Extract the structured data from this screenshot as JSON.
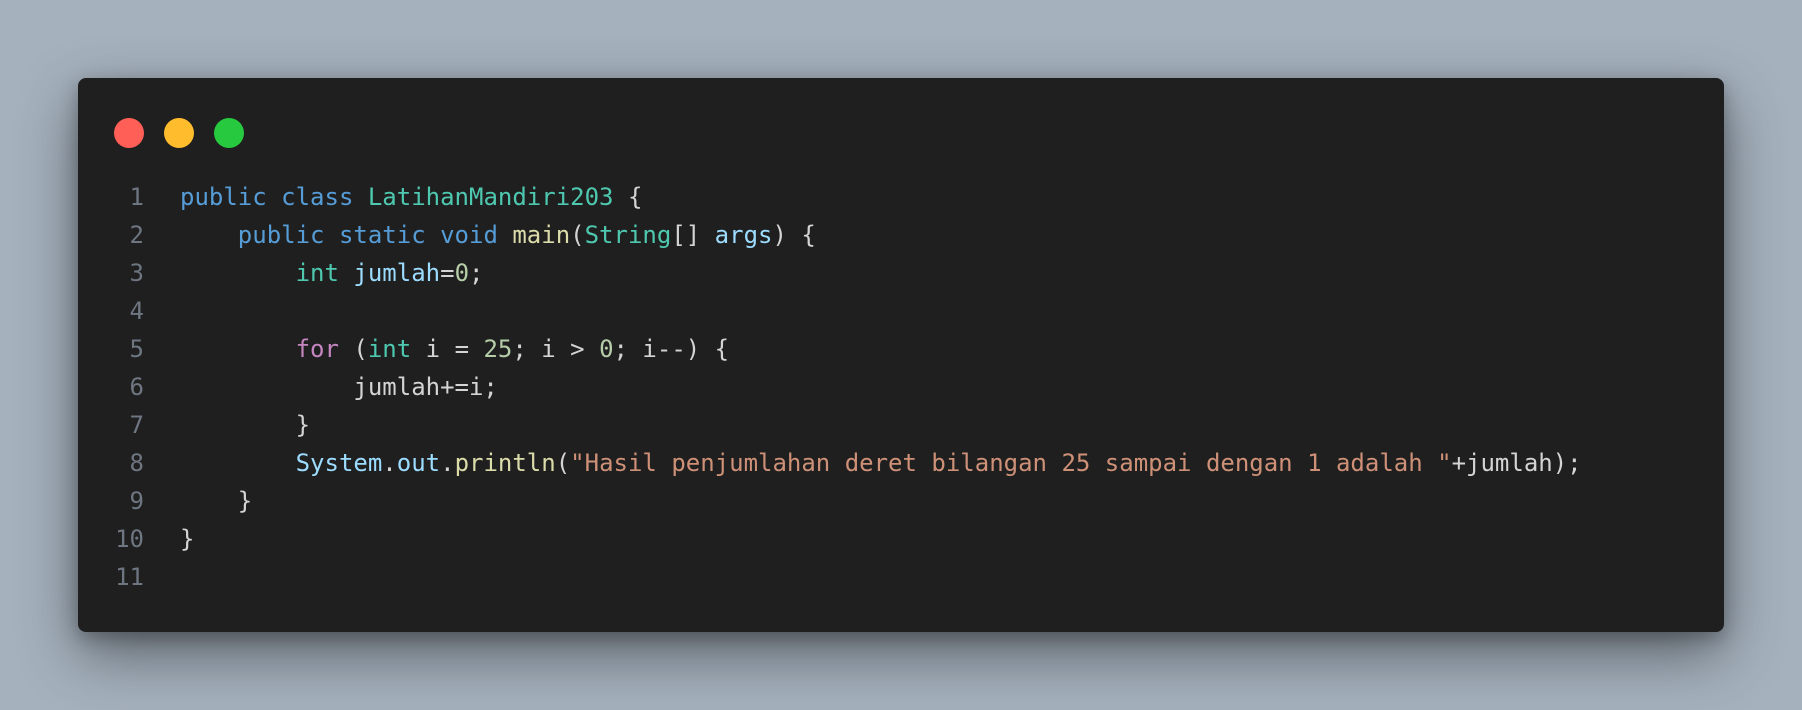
{
  "window": {
    "controls": {
      "close_color": "#ff5f56",
      "minimize_color": "#ffbd2e",
      "maximize_color": "#27c93f"
    }
  },
  "code": {
    "language": "java",
    "lines": [
      {
        "number": "1",
        "tokens": [
          {
            "t": "public",
            "c": "kw"
          },
          {
            "t": " ",
            "c": "pl"
          },
          {
            "t": "class",
            "c": "kw"
          },
          {
            "t": " ",
            "c": "pl"
          },
          {
            "t": "LatihanMandiri203",
            "c": "ty"
          },
          {
            "t": " {",
            "c": "pl"
          }
        ]
      },
      {
        "number": "2",
        "tokens": [
          {
            "t": "    ",
            "c": "pl"
          },
          {
            "t": "public",
            "c": "kw"
          },
          {
            "t": " ",
            "c": "pl"
          },
          {
            "t": "static",
            "c": "kw"
          },
          {
            "t": " ",
            "c": "pl"
          },
          {
            "t": "void",
            "c": "kw"
          },
          {
            "t": " ",
            "c": "pl"
          },
          {
            "t": "main",
            "c": "fn"
          },
          {
            "t": "(",
            "c": "pl"
          },
          {
            "t": "String",
            "c": "ty"
          },
          {
            "t": "[] ",
            "c": "pl"
          },
          {
            "t": "args",
            "c": "var"
          },
          {
            "t": ") {",
            "c": "pl"
          }
        ]
      },
      {
        "number": "3",
        "tokens": [
          {
            "t": "        ",
            "c": "pl"
          },
          {
            "t": "int",
            "c": "ty"
          },
          {
            "t": " ",
            "c": "pl"
          },
          {
            "t": "jumlah",
            "c": "var"
          },
          {
            "t": "=",
            "c": "pl"
          },
          {
            "t": "0",
            "c": "num"
          },
          {
            "t": ";",
            "c": "pl"
          }
        ]
      },
      {
        "number": "4",
        "tokens": []
      },
      {
        "number": "5",
        "tokens": [
          {
            "t": "        ",
            "c": "pl"
          },
          {
            "t": "for",
            "c": "ctl"
          },
          {
            "t": " (",
            "c": "pl"
          },
          {
            "t": "int",
            "c": "ty"
          },
          {
            "t": " i = ",
            "c": "pl"
          },
          {
            "t": "25",
            "c": "num"
          },
          {
            "t": "; i > ",
            "c": "pl"
          },
          {
            "t": "0",
            "c": "num"
          },
          {
            "t": "; i--) {",
            "c": "pl"
          }
        ]
      },
      {
        "number": "6",
        "tokens": [
          {
            "t": "            jumlah+=i;",
            "c": "pl"
          }
        ]
      },
      {
        "number": "7",
        "tokens": [
          {
            "t": "        }",
            "c": "pl"
          }
        ]
      },
      {
        "number": "8",
        "tokens": [
          {
            "t": "        ",
            "c": "pl"
          },
          {
            "t": "System",
            "c": "var"
          },
          {
            "t": ".",
            "c": "pl"
          },
          {
            "t": "out",
            "c": "var"
          },
          {
            "t": ".",
            "c": "pl"
          },
          {
            "t": "println",
            "c": "fn"
          },
          {
            "t": "(",
            "c": "pl"
          },
          {
            "t": "\"Hasil penjumlahan deret bilangan 25 sampai dengan 1 adalah \"",
            "c": "str"
          },
          {
            "t": "+jumlah);",
            "c": "pl"
          }
        ]
      },
      {
        "number": "9",
        "tokens": [
          {
            "t": "    }",
            "c": "pl"
          }
        ]
      },
      {
        "number": "10",
        "tokens": [
          {
            "t": "}",
            "c": "pl"
          }
        ]
      },
      {
        "number": "11",
        "tokens": []
      }
    ]
  }
}
